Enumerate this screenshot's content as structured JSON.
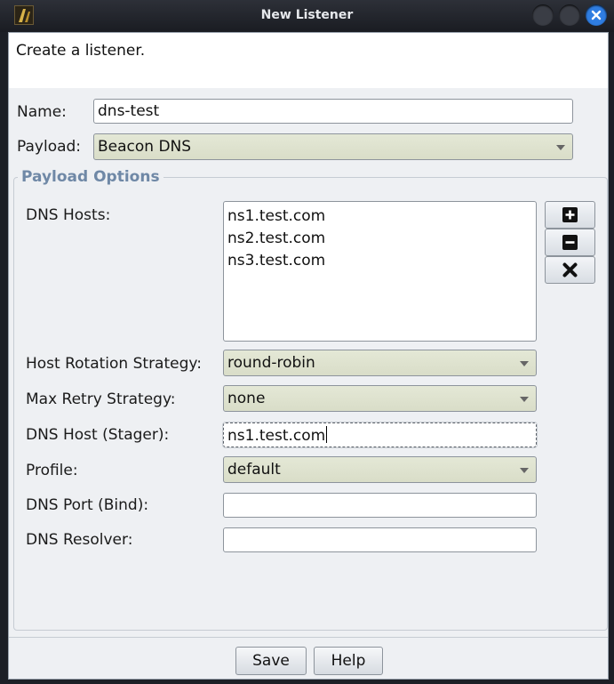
{
  "window": {
    "title": "New Listener"
  },
  "description": "Create a listener.",
  "name": {
    "label": "Name:",
    "value": "dns-test"
  },
  "payload": {
    "label": "Payload:",
    "value": "Beacon DNS"
  },
  "payload_options": {
    "title": "Payload Options",
    "dns_hosts": {
      "label": "DNS Hosts:",
      "items": [
        "ns1.test.com",
        "ns2.test.com",
        "ns3.test.com"
      ]
    },
    "host_rotation": {
      "label": "Host Rotation Strategy:",
      "value": "round-robin"
    },
    "max_retry": {
      "label": "Max Retry Strategy:",
      "value": "none"
    },
    "dns_host_stager": {
      "label": "DNS Host (Stager):",
      "value": "ns1.test.com"
    },
    "profile": {
      "label": "Profile:",
      "value": "default"
    },
    "dns_port_bind": {
      "label": "DNS Port (Bind):",
      "value": ""
    },
    "dns_resolver": {
      "label": "DNS Resolver:",
      "value": ""
    }
  },
  "buttons": {
    "save": "Save",
    "help": "Help"
  },
  "icons": {
    "add": "plus-icon",
    "remove": "minus-icon",
    "clear": "x-icon",
    "close": "close-icon"
  },
  "colors": {
    "accent": "#2f7de1",
    "group_title": "#6f88a6",
    "combo_bg": "#dfe3ce"
  }
}
